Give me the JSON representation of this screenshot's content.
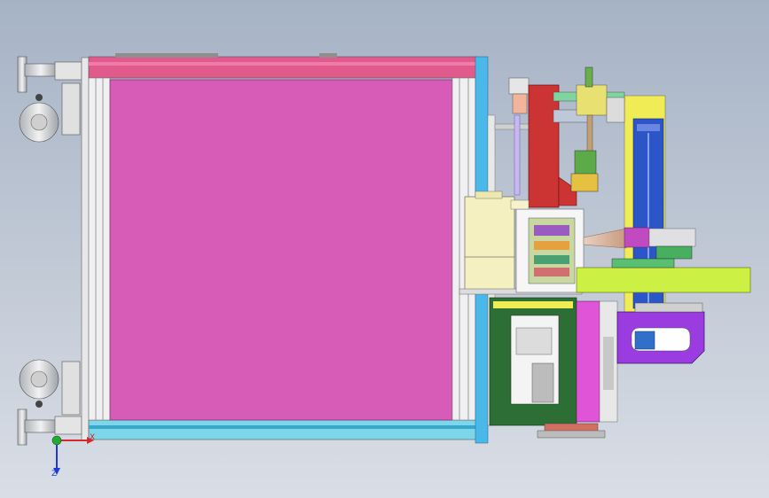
{
  "viewport": {
    "background_top": "#a6b3c6",
    "background_bottom": "#d9dee6"
  },
  "colors": {
    "frame_panel": "#d65cb8",
    "frame_bar_top": "#e05a8c",
    "cyan_bar": "#4ab8e8",
    "red_plate": "#cc3333",
    "lime_plate": "#ccf044",
    "yellow_column": "#f0ec55",
    "blue_cylinder": "#2c55c8",
    "dark_green_block": "#2d6e35",
    "purple_bracket": "#9b3ce0",
    "magenta_plate": "#e055d8",
    "cream_motor": "#f4f0c0",
    "grey_caster": "#d8d8d8"
  },
  "triad": {
    "x_label": "X",
    "z_label": "Z",
    "x_color": "#d62828",
    "y_color": "#22aa33",
    "z_color": "#1d3bd6"
  },
  "icons": {
    "caster_top": "caster-wheel-icon",
    "caster_bottom": "caster-wheel-icon",
    "triad": "coordinate-triad-icon"
  }
}
